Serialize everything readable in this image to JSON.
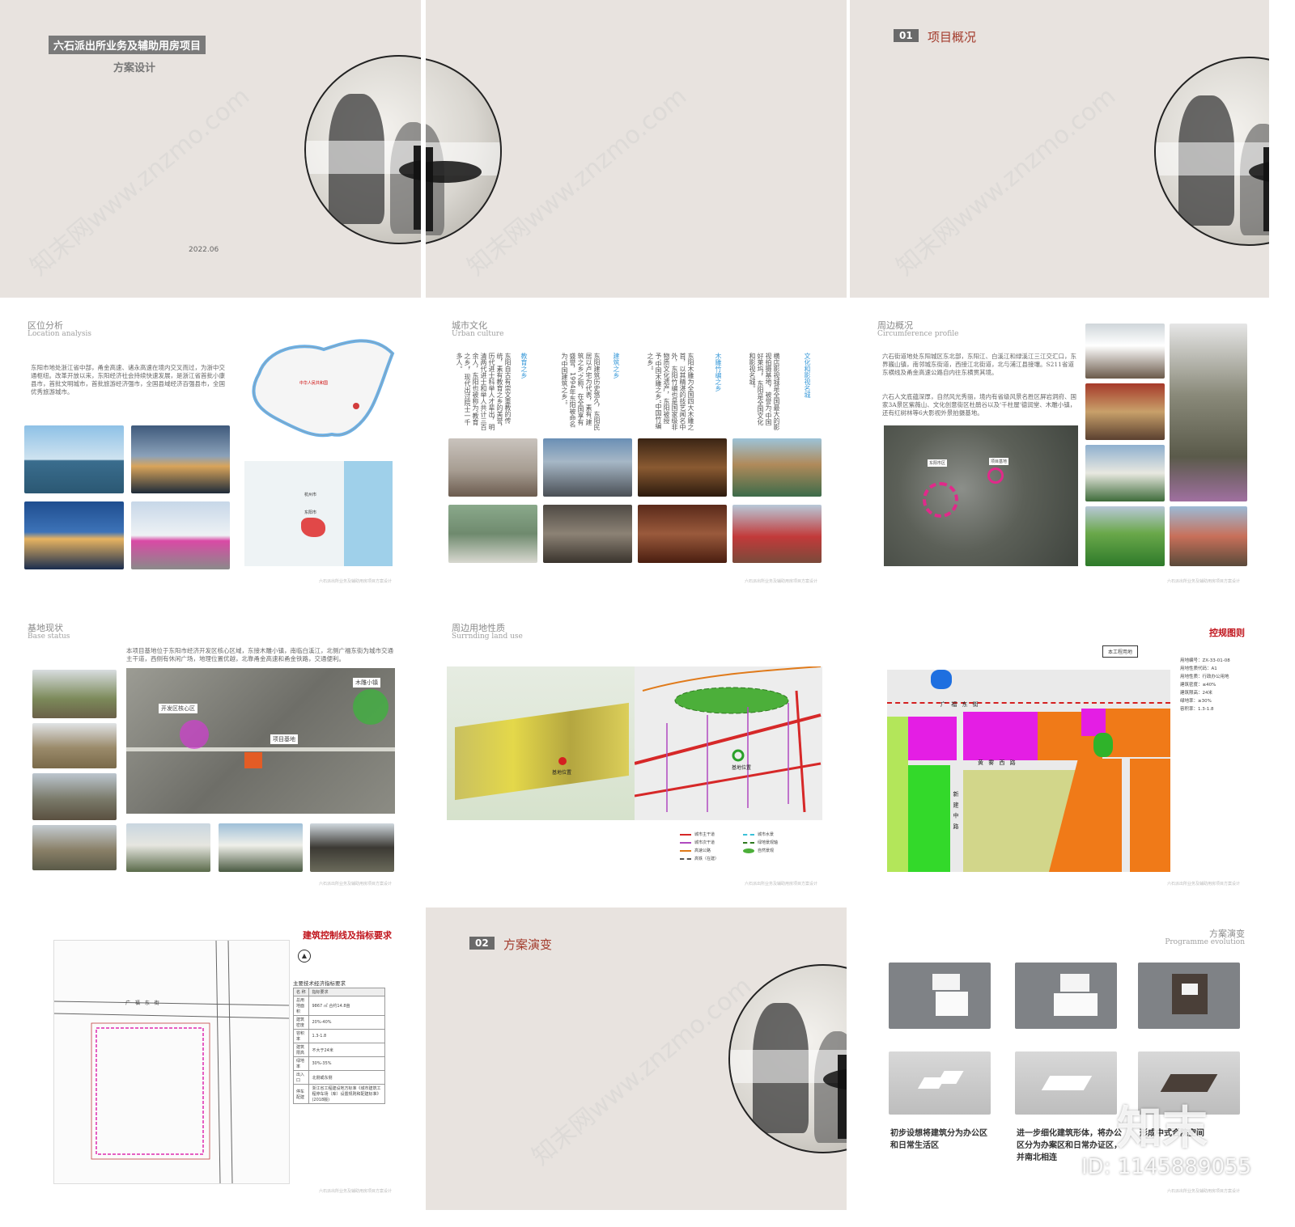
{
  "cover": {
    "title": "六石派出所业务及辅助用房项目",
    "subtitle": "方案设计",
    "date": "2022.06"
  },
  "section1": {
    "num": "01",
    "title": "项目概况"
  },
  "location": {
    "title_cn": "区位分析",
    "title_en": "Location  analysis",
    "text": "东阳市地处浙江省中部，甬金高速、诸永高速在境内交叉而过，为浙中交通枢纽。改革开放以来，东阳经济社会持续快速发展，是浙江省首批小康县市，首批文明城市，首批旅游经济强市，全国县域经济百强县市，全国优秀旅游城市。",
    "map_label_1": "中华人民共和国",
    "map_label_2": "杭州市",
    "map_label_3": "东阳市"
  },
  "culture": {
    "title_cn": "城市文化",
    "title_en": "Urban  culture",
    "col1_head": "教育之乡",
    "col1": "东阳自古有崇文重教的传统，素有教育之乡的美誉，历代进士科举人才辈出，明清两代进士和举人共计三百余人，东阳也被称为'教育之乡'，现代出过院士一千多人。",
    "col2_head": "建筑之乡",
    "col2": "东阳建筑历史悠久，东阳民居以卢宅为代表，素有'建筑之乡'之称，在全国享有盛誉，1994年东阳被命名为'中国建筑之乡'。",
    "col3_head": "木雕竹编之乡",
    "col3": "东阳木雕为全国四大木雕之首，以其精湛的技艺闻名中外，东阳竹编也是国家级非物质文化遗产，东阳被授予'中国木雕之乡''中国竹编之乡'。",
    "col4_head": "文化和影视名城",
    "col4": "横店影视城是全国最大的影视拍摄基地，被誉为'中国好莱坞'，东阳是全国文化和影视名城。"
  },
  "surround": {
    "title_cn": "周边概况",
    "title_en": "Circumference  profile",
    "text1": "六石街道地处东阳城区东北部，东阳江、白溪江和绿溪江三江交汇口，东界巍山镇，南邻城东街道，西接江北街道，北与浦江县接壤。S211省道东横线及甬金高速公路自内往东横贯其境。",
    "text2": "六石人文底蕴深厚，自然风光秀丽，境内有省级风景名胜区屏岩洞府、国家3A景区紫薇山、文化创意街区杜鹃谷以及'千柱屋'德润堂、木雕小镇，还有红树林等6大影视外景拍摄基地。",
    "label_a": "东阳市区",
    "label_b": "项目基地"
  },
  "base": {
    "title_cn": "基地现状",
    "title_en": "Base  status",
    "text": "本项目基地位于东阳市经济开发区核心区域，东接木雕小镇，南临白溪江，北侧广福东街为城市交通主干道，西侧有休闲广场，地理位置优越，北靠甬金高速和甬金铁路，交通便利。",
    "label_core": "开发区核心区",
    "label_site": "项目基地",
    "label_town": "木雕小镇"
  },
  "landuse": {
    "title_cn": "周边用地性质",
    "title_en": "Surrnding  land  use",
    "map_label": "基地位置",
    "legend": [
      "城市主干道",
      "城市次干道",
      "高速公路",
      "高铁（在建）",
      "城市水景",
      "绿地景观轴",
      "自然景观"
    ]
  },
  "control": {
    "title": "控规图则",
    "tag": "本工程用地",
    "street1": "广 福 东 街",
    "street2": "黄 雾 西 路",
    "street3": "新 建 中 路",
    "info": [
      "用地编号：ZX-33-01-08",
      "用地性质代码：A1",
      "用地性质：行政办公用地",
      "建筑密度：≤40%",
      "建筑限高：24米",
      "绿地率：≥30%",
      "容积率：1.3-1.8"
    ]
  },
  "redline": {
    "title": "建筑控制线及指标要求",
    "table_title": "主要技术经济指标要求",
    "rows": [
      [
        "名 称",
        "指标要求"
      ],
      [
        "总用地面积",
        "9867 ㎡    合约14.8亩"
      ],
      [
        "建筑密度",
        "20%-40%"
      ],
      [
        "容积率",
        "1.3-1.8"
      ],
      [
        "建筑限高",
        "不大于24米"
      ],
      [
        "绿地率",
        "30%-35%"
      ],
      [
        "出入口",
        "北侧或东侧"
      ],
      [
        "停车配建",
        "浙江省工程建设地方标准《城市建筑工程停车场（库）设置规则和配建标准》(2018版)"
      ]
    ],
    "street": "广 福 东 街"
  },
  "section2": {
    "num": "02",
    "title": "方案演变"
  },
  "evolution": {
    "title_cn": "方案演变",
    "title_en": "Programme  evolution",
    "caption1": "初步设想将建筑分为办公区和日常生活区",
    "caption2": "进一步细化建筑形体，将办公区分为办案区和日常办证区，并南北相连",
    "caption3": "形成中式合院空间"
  },
  "brand": {
    "logo": "知末",
    "id": "ID: 1145889055",
    "watermark": "知末网www.znzmo.com"
  },
  "footer": "六石派出所业务及辅助用房项目方案设计",
  "colors": {
    "beige": "#e8e3df",
    "accent_red": "#c0141c",
    "section_red": "#a33b2c"
  }
}
